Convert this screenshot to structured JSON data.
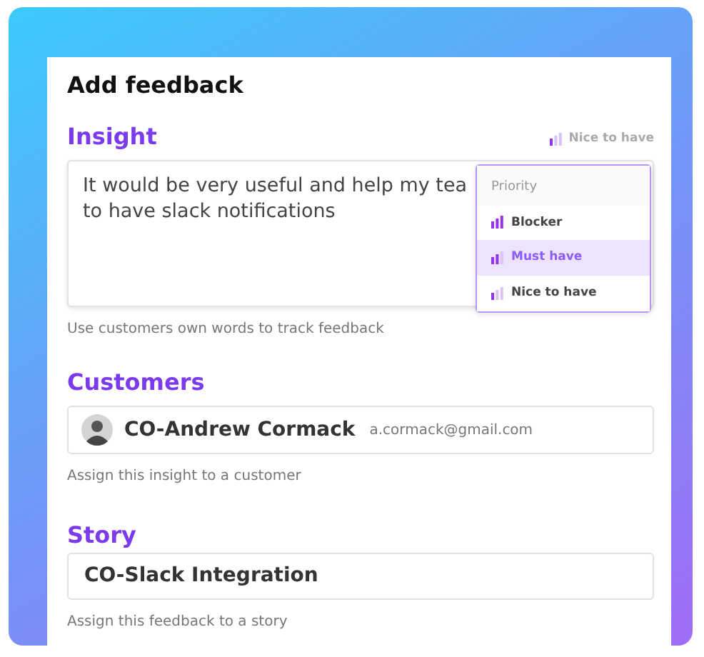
{
  "title": "Add feedback",
  "insight": {
    "label": "Insight",
    "priority": {
      "kind": "low",
      "label": "Nice to have"
    },
    "text_lines": [
      "It would be very useful and help my tea",
      "to have slack notifications"
    ],
    "dropdown": {
      "header": "Priority",
      "options": [
        {
          "kind": "high",
          "label": "Blocker",
          "selected": false
        },
        {
          "kind": "medium",
          "label": "Must have",
          "selected": true
        },
        {
          "kind": "low",
          "label": "Nice to have",
          "selected": false
        }
      ]
    },
    "help": "Use customers own words to track feedback"
  },
  "customers": {
    "label": "Customers",
    "name": "CO-Andrew Cormack",
    "email": "a.cormack@gmail.com",
    "help": "Assign this insight to a customer"
  },
  "story": {
    "label": "Story",
    "value": "CO-Slack Integration",
    "help": "Assign this feedback to a story"
  }
}
